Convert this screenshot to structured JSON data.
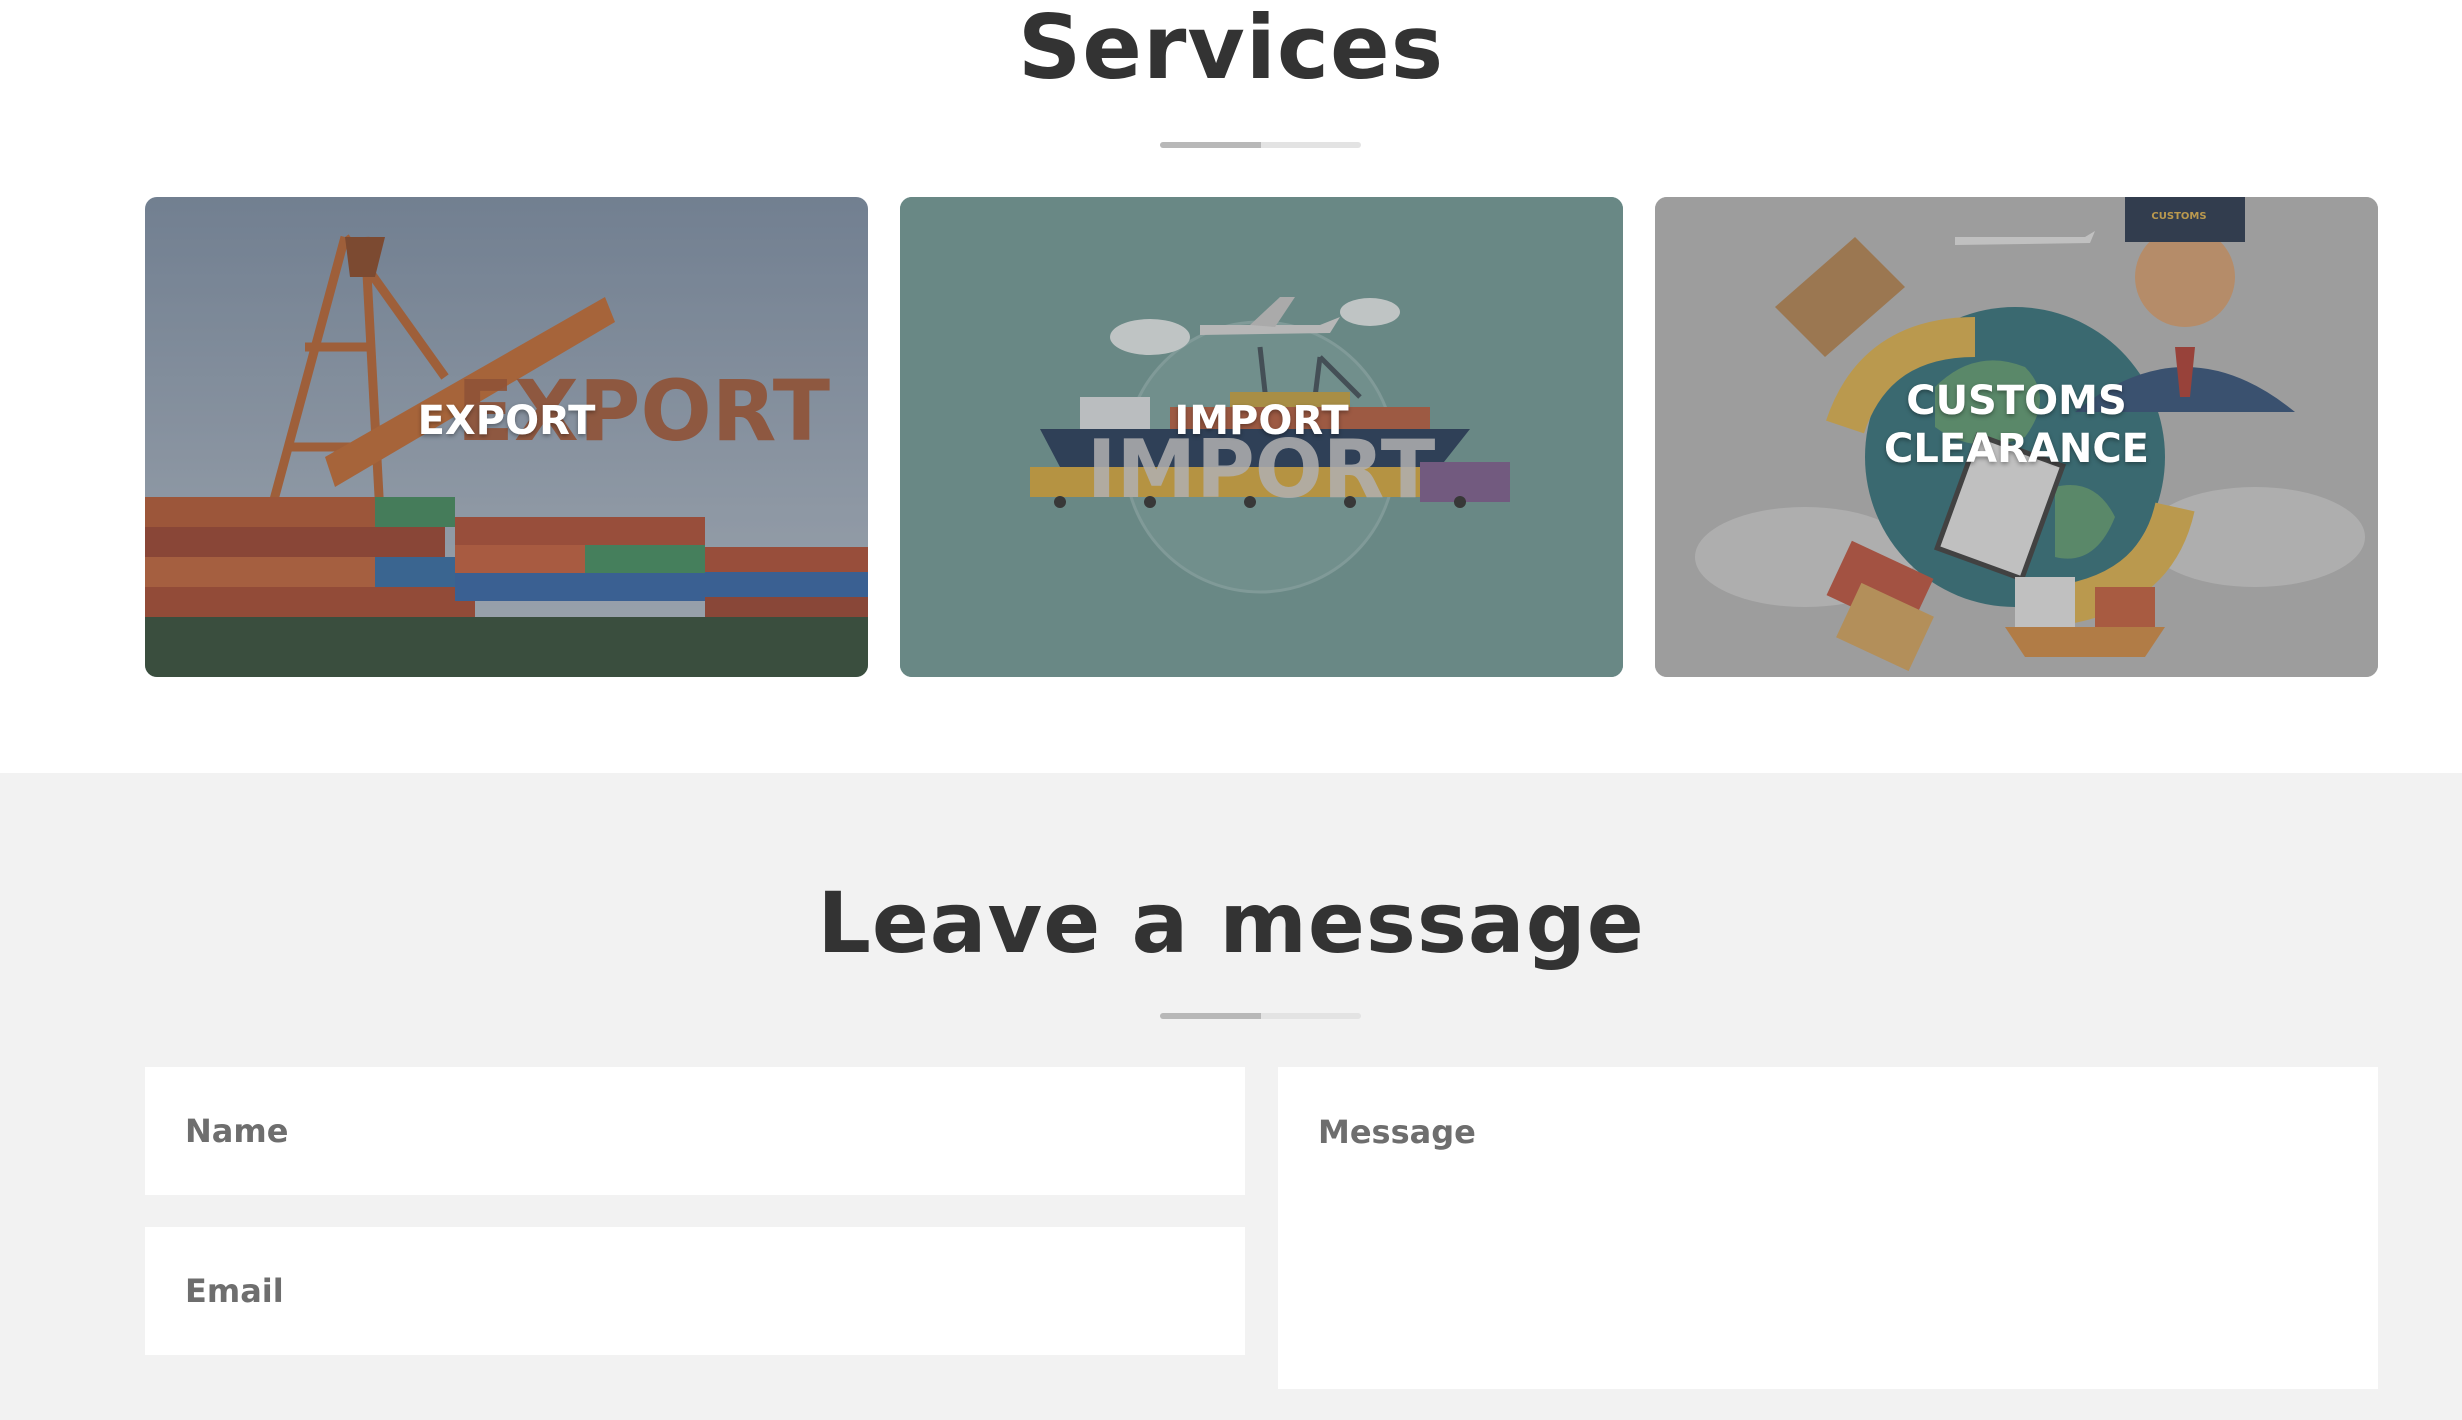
{
  "services": {
    "title": "Services",
    "cards": [
      {
        "label": "EXPORT",
        "image_text": "EXPORT"
      },
      {
        "label": "IMPORT",
        "image_text": "IMPORT"
      },
      {
        "label_line1": "CUSTOMS",
        "label_line2": "CLEARANCE",
        "image_text": "CUSTOMS"
      }
    ]
  },
  "contact": {
    "title": "Leave a message",
    "name_placeholder": "Name",
    "email_placeholder": "Email",
    "message_placeholder": "Message"
  },
  "colors": {
    "heading": "#333333",
    "contact_background": "#f2f2f2",
    "import_card": "#628a87",
    "customs_card": "#9c9c9c"
  }
}
